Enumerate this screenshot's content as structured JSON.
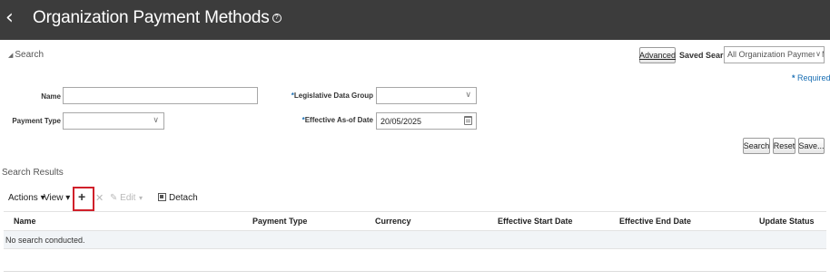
{
  "header": {
    "title": "Organization Payment Methods",
    "back_glyph": "‹",
    "help_glyph": "?"
  },
  "search": {
    "toggle_label": "Search",
    "toggle_glyph": "◢",
    "advanced_label": "Advanced",
    "saved_search_label": "Saved Search",
    "saved_search_value": "All Organization Payment M",
    "required_star": "*",
    "required_label": "Required",
    "fields": {
      "name_label": "Name",
      "name_value": "",
      "payment_type_label": "Payment Type",
      "payment_type_value": "",
      "ldg_label": "Legislative Data Group",
      "ldg_value": "",
      "effective_date_label": "Effective As-of Date",
      "effective_date_value": "20/05/2025"
    },
    "buttons": {
      "search": "Search",
      "reset": "Reset",
      "save": "Save..."
    }
  },
  "results": {
    "title": "Search Results",
    "toolbar": {
      "actions": "Actions ▾",
      "view": "View ▾",
      "add_glyph": "+",
      "delete_glyph": "✕",
      "edit_glyph": "✎",
      "edit": "Edit",
      "edit_menu_glyph": "▾",
      "detach": "Detach"
    },
    "columns": [
      "Name",
      "Payment Type",
      "Currency",
      "Effective Start Date",
      "Effective End Date",
      "Update Status"
    ],
    "empty_message": "No search conducted."
  },
  "colors": {
    "header_bg": "#3c3c3c",
    "required_blue": "#1a6fb4",
    "highlight_red": "#d0202a",
    "row_bg": "#f1f4f7"
  }
}
